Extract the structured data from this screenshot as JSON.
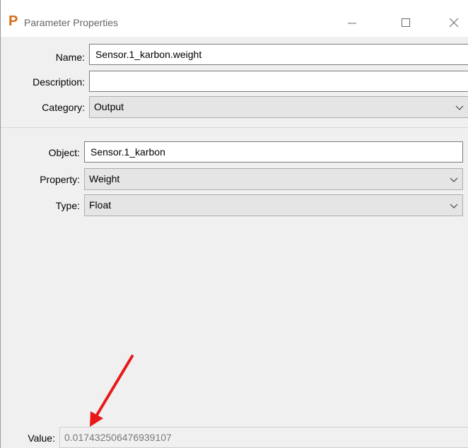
{
  "window": {
    "title": "Parameter Properties",
    "app_icon": "P"
  },
  "form": {
    "name_label": "Name:",
    "name_value": "Sensor.1_karbon.weight",
    "description_label": "Description:",
    "description_value": "",
    "category_label": "Category:",
    "category_value": "Output"
  },
  "object_panel": {
    "object_label": "Object:",
    "object_value": "Sensor.1_karbon",
    "property_label": "Property:",
    "property_value": "Weight",
    "type_label": "Type:",
    "type_value": "Float"
  },
  "footer": {
    "value_label": "Value:",
    "value_text": "0.017432506476939107"
  },
  "annotation": {
    "arrow_color": "#e8191a"
  }
}
